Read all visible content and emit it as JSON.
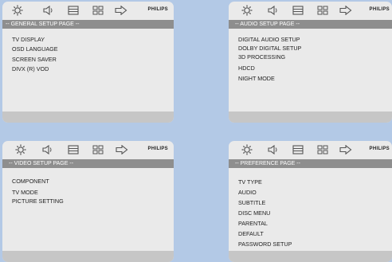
{
  "brand": "PHILIPS",
  "toolbar_icons": [
    "settings-icon",
    "audio-icon",
    "screen-icon",
    "grid-icon",
    "exit-icon"
  ],
  "panels": [
    {
      "header": "-- GENERAL SETUP PAGE --",
      "items": [
        "TV DISPLAY",
        "OSD LANGUAGE",
        "SCREEN SAVER",
        "DIVX (R) VOD"
      ]
    },
    {
      "header": "-- AUDIO SETUP PAGE --",
      "items": [
        "DIGITAL AUDIO SETUP",
        "DOLBY DIGITAL SETUP",
        "3D PROCESSING",
        "HDCD",
        "NIGHT MODE"
      ]
    },
    {
      "header": "-- VIDEO SETUP PAGE --",
      "items": [
        "COMPONENT",
        "TV MODE",
        "PICTURE SETTING"
      ]
    },
    {
      "header": "-- PREFERENCE PAGE --",
      "items": [
        "TV TYPE",
        "AUDIO",
        "SUBTITLE",
        "DISC MENU",
        "PARENTAL",
        "DEFAULT",
        "PASSWORD SETUP"
      ]
    }
  ],
  "colors": {
    "background": "#b3c9e6",
    "panel": "#eaeaea",
    "header_bar": "#8e8e8e",
    "footer_bar": "#c6c6c6"
  }
}
